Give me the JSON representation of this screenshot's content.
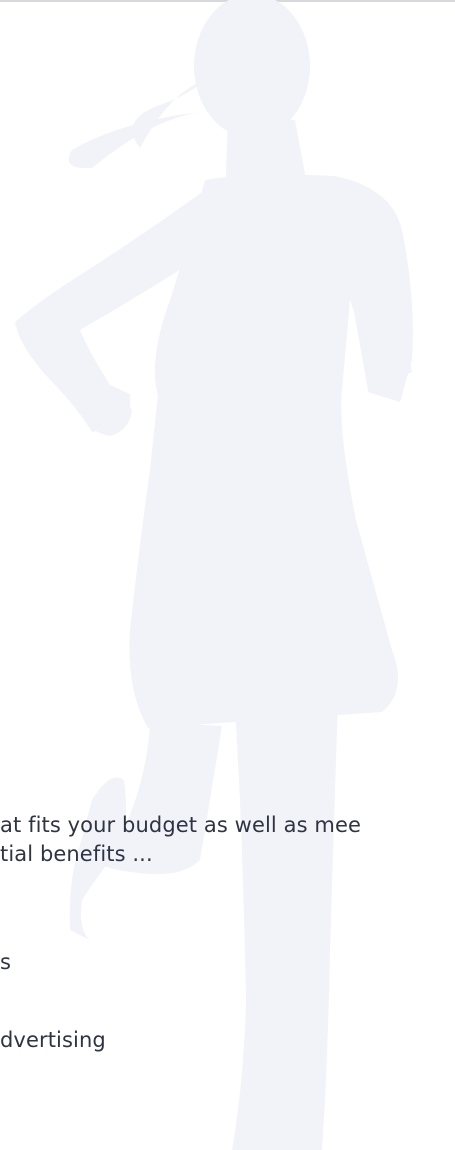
{
  "content": {
    "intro_line_1": "at fits your budget as well as mee",
    "intro_line_2": "tial benefits ...",
    "item_1": "s",
    "item_2": "dvertising"
  },
  "colors": {
    "background": "#ffffff",
    "silhouette": "#f1f3f9",
    "text": "#2f3442",
    "top_rule": "#d7d9de"
  },
  "decor": {
    "background_icon": "running-woman-silhouette-icon"
  }
}
